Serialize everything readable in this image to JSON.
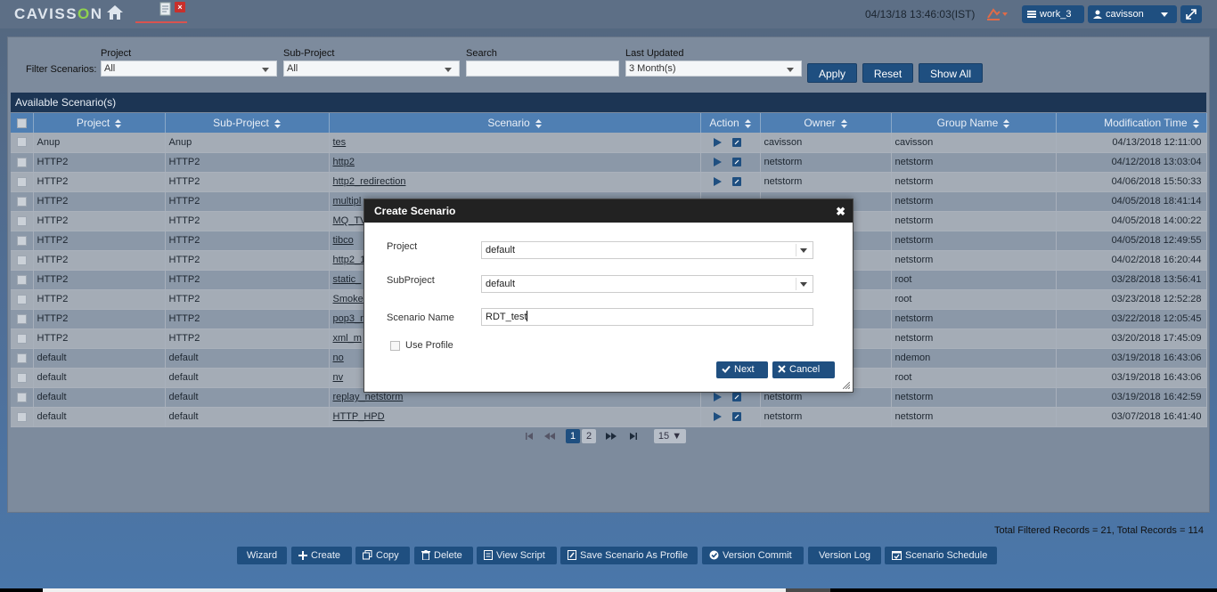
{
  "header": {
    "logo_pre": "CAVISS",
    "logo_o": "O",
    "logo_post": "N",
    "datetime": "04/13/18 13:46:03(IST)",
    "workspace": "work_3",
    "user": "cavisson"
  },
  "filters": {
    "title": "Filter Scenarios:",
    "project_label": "Project",
    "project_value": "All",
    "subproject_label": "Sub-Project",
    "subproject_value": "All",
    "search_label": "Search",
    "search_value": "",
    "last_updated_label": "Last Updated",
    "last_updated_value": "3 Month(s)",
    "apply": "Apply",
    "reset": "Reset",
    "show_all": "Show All"
  },
  "table": {
    "caption": "Available Scenario(s)",
    "columns": [
      "Project",
      "Sub-Project",
      "Scenario",
      "Action",
      "Owner",
      "Group Name",
      "Modification Time"
    ],
    "rows": [
      [
        "Anup",
        "Anup",
        "tes",
        "cavisson",
        "cavisson",
        "04/13/2018 12:11:00"
      ],
      [
        "HTTP2",
        "HTTP2",
        "http2",
        "netstorm",
        "netstorm",
        "04/12/2018 13:03:04"
      ],
      [
        "HTTP2",
        "HTTP2",
        "http2_redirection",
        "netstorm",
        "netstorm",
        "04/06/2018 15:50:33"
      ],
      [
        "HTTP2",
        "HTTP2",
        "multipl",
        "",
        "netstorm",
        "04/05/2018 18:41:14"
      ],
      [
        "HTTP2",
        "HTTP2",
        "MQ_TV",
        "",
        "netstorm",
        "04/05/2018 14:00:22"
      ],
      [
        "HTTP2",
        "HTTP2",
        "tibco",
        "",
        "netstorm",
        "04/05/2018 12:49:55"
      ],
      [
        "HTTP2",
        "HTTP2",
        "http2_1",
        "",
        "netstorm",
        "04/02/2018 16:20:44"
      ],
      [
        "HTTP2",
        "HTTP2",
        "static_",
        "",
        "root",
        "03/28/2018 13:56:41"
      ],
      [
        "HTTP2",
        "HTTP2",
        "Smoke",
        "",
        "root",
        "03/23/2018 12:52:28"
      ],
      [
        "HTTP2",
        "HTTP2",
        "pop3_r",
        "",
        "netstorm",
        "03/22/2018 12:05:45"
      ],
      [
        "HTTP2",
        "HTTP2",
        "xml_m",
        "",
        "netstorm",
        "03/20/2018 17:45:09"
      ],
      [
        "default",
        "default",
        "no",
        "",
        "ndemon",
        "03/19/2018 16:43:06"
      ],
      [
        "default",
        "default",
        "nv",
        "",
        "root",
        "03/19/2018 16:43:06"
      ],
      [
        "default",
        "default",
        "replay_netstorm",
        "netstorm",
        "netstorm",
        "03/19/2018 16:42:59"
      ],
      [
        "default",
        "default",
        "HTTP_HPD",
        "netstorm",
        "netstorm",
        "03/07/2018 16:41:40"
      ]
    ]
  },
  "pager": {
    "pages": [
      "1",
      "2"
    ],
    "page_size": "15"
  },
  "totals": "Total Filtered Records = 21, Total Records = 114",
  "footer_buttons": {
    "wizard": "Wizard",
    "create": "Create",
    "copy": "Copy",
    "delete": "Delete",
    "view_script": "View Script",
    "save_profile": "Save Scenario As Profile",
    "version_commit": "Version Commit",
    "version_log": "Version Log",
    "schedule": "Scenario Schedule"
  },
  "modal": {
    "title": "Create Scenario",
    "project_label": "Project",
    "project_value": "default",
    "subproject_label": "SubProject",
    "subproject_value": "default",
    "name_label": "Scenario Name",
    "name_value": "RDT_test",
    "use_profile": "Use Profile",
    "next": "Next",
    "cancel": "Cancel"
  },
  "colors": {
    "header_bg": "#5d6f86",
    "button": "#1f4f80",
    "table_header": "#4f7fb3",
    "modal_header": "#222222",
    "logo_accent": "#8fd14f"
  }
}
